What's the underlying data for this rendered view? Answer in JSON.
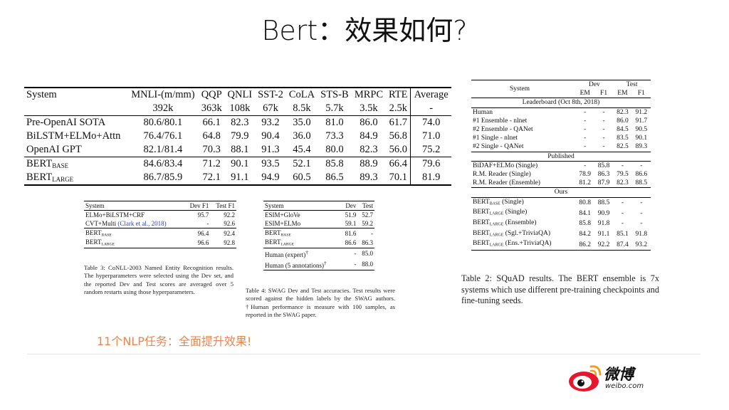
{
  "title": "Bert：效果如何?",
  "glue": {
    "header": [
      "System",
      "MNLI-(m/mm)",
      "QQP",
      "QNLI",
      "SST-2",
      "CoLA",
      "STS-B",
      "MRPC",
      "RTE",
      "Average"
    ],
    "sizes": [
      "",
      "392k",
      "363k",
      "108k",
      "67k",
      "8.5k",
      "5.7k",
      "3.5k",
      "2.5k",
      "-"
    ],
    "rows": [
      {
        "system": "Pre-OpenAI SOTA",
        "vals": [
          "80.6/80.1",
          "66.1",
          "82.3",
          "93.2",
          "35.0",
          "81.0",
          "86.0",
          "61.7",
          "74.0"
        ]
      },
      {
        "system": "BiLSTM+ELMo+Attn",
        "vals": [
          "76.4/76.1",
          "64.8",
          "79.9",
          "90.4",
          "36.0",
          "73.3",
          "84.9",
          "56.8",
          "71.0"
        ]
      },
      {
        "system": "OpenAI GPT",
        "vals": [
          "82.1/81.4",
          "70.3",
          "88.1",
          "91.3",
          "45.4",
          "80.0",
          "82.3",
          "56.0",
          "75.2"
        ]
      },
      {
        "system": "BERT",
        "sub": "BASE",
        "vals": [
          "84.6/83.4",
          "71.2",
          "90.1",
          "93.5",
          "52.1",
          "85.8",
          "88.9",
          "66.4",
          "79.6"
        ]
      },
      {
        "system": "BERT",
        "sub": "LARGE",
        "vals": [
          "86.7/85.9",
          "72.1",
          "91.1",
          "94.9",
          "60.5",
          "86.5",
          "89.3",
          "70.1",
          "81.9"
        ]
      }
    ]
  },
  "ner": {
    "header": [
      "System",
      "Dev F1",
      "Test F1"
    ],
    "rows": [
      {
        "system": "ELMo+BiLSTM+CRF",
        "dev": "95.7",
        "test": "92.2"
      },
      {
        "system": "CVT+Multi",
        "cite": "(Clark et al., 2018)",
        "dev": "-",
        "test": "92.6"
      },
      {
        "system": "BERT",
        "sub": "BASE",
        "dev": "96.4",
        "test": "92.4"
      },
      {
        "system": "BERT",
        "sub": "LARGE",
        "dev": "96.6",
        "test": "92.8"
      }
    ],
    "caption": "Table 3: CoNLL-2003 Named Entity Recognition results. The hyperparameters were selected using the Dev set, and the reported Dev and Test scores are averaged over 5 random restarts using those hyperparameters."
  },
  "swag": {
    "header": [
      "System",
      "Dev",
      "Test"
    ],
    "rows": [
      {
        "system": "ESIM+GloVe",
        "dev": "51.9",
        "test": "52.7"
      },
      {
        "system": "ESIM+ELMo",
        "dev": "59.1",
        "test": "59.2"
      },
      {
        "system": "BERT",
        "sub": "BASE",
        "dev": "81.6",
        "test": "-"
      },
      {
        "system": "BERT",
        "sub": "LARGE",
        "dev": "86.6",
        "test": "86.3"
      },
      {
        "system": "Human (expert)",
        "sup": "†",
        "dev": "-",
        "test": "85.0"
      },
      {
        "system": "Human (5 annotations)",
        "sup": "†",
        "dev": "-",
        "test": "88.0"
      }
    ],
    "caption": "Table 4: SWAG Dev and Test accuracies. Test results were scored against the hidden labels by the SWAG authors. †Human performance is measure with 100 samples, as reported in the SWAG paper."
  },
  "squad": {
    "header": {
      "system": "System",
      "dev": "Dev",
      "test": "Test",
      "em": "EM",
      "f1": "F1"
    },
    "sections": [
      {
        "title": "Leaderboard (Oct 8th, 2018)",
        "rows": [
          {
            "system": "Human",
            "vals": [
              "-",
              "-",
              "82.3",
              "91.2"
            ]
          },
          {
            "system": "#1 Ensemble - nlnet",
            "vals": [
              "-",
              "-",
              "86.0",
              "91.7"
            ]
          },
          {
            "system": "#2 Ensemble - QANet",
            "vals": [
              "-",
              "-",
              "84.5",
              "90.5"
            ]
          },
          {
            "system": "#1 Single - nlnet",
            "vals": [
              "-",
              "-",
              "83.5",
              "90.1"
            ]
          },
          {
            "system": "#2 Single - QANet",
            "vals": [
              "-",
              "-",
              "82.5",
              "89.3"
            ]
          }
        ]
      },
      {
        "title": "Published",
        "rows": [
          {
            "system": "BiDAF+ELMo (Single)",
            "vals": [
              "-",
              "85.8",
              "-",
              "-"
            ]
          },
          {
            "system": "R.M. Reader (Single)",
            "vals": [
              "78.9",
              "86.3",
              "79.5",
              "86.6"
            ]
          },
          {
            "system": "R.M. Reader (Ensemble)",
            "vals": [
              "81.2",
              "87.9",
              "82.3",
              "88.5"
            ]
          }
        ]
      },
      {
        "title": "Ours",
        "rows": [
          {
            "system": "BERT",
            "sub": "BASE",
            "suffix": " (Single)",
            "vals": [
              "80.8",
              "88.5",
              "-",
              "-"
            ]
          },
          {
            "system": "BERT",
            "sub": "LARGE",
            "suffix": " (Single)",
            "vals": [
              "84.1",
              "90.9",
              "-",
              "-"
            ]
          },
          {
            "system": "BERT",
            "sub": "LARGE",
            "suffix": " (Ensemble)",
            "vals": [
              "85.8",
              "91.8",
              "-",
              "-"
            ]
          },
          {
            "system": "BERT",
            "sub": "LARGE",
            "suffix": " (Sgl.+TriviaQA)",
            "vals": [
              "84.2",
              "91.1",
              "85.1",
              "91.8"
            ]
          },
          {
            "system": "BERT",
            "sub": "LARGE",
            "suffix": " (Ens.+TriviaQA)",
            "vals": [
              "86.2",
              "92.2",
              "87.4",
              "93.2"
            ]
          }
        ]
      }
    ],
    "caption": "Table 2: SQuAD results. The BERT ensemble is 7x systems which use different pre-training checkpoints and fine-tuning seeds."
  },
  "highlight": "11个NLP任务：全面提升效果!",
  "logo": {
    "name": "微博",
    "url": "weibo.com",
    "colors": {
      "red": "#e6162d",
      "orange": "#f39c1f",
      "black": "#111111"
    }
  },
  "colors": {
    "highlight": "#e8864d",
    "divider": "#d6eaf5",
    "cite": "#2a40b0"
  }
}
